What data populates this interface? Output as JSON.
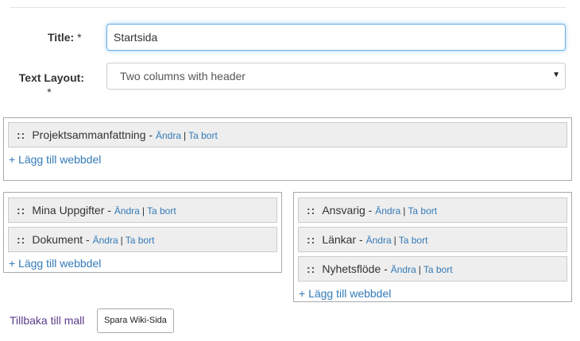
{
  "form": {
    "title_label": "Title:",
    "title_required": "*",
    "title_value": "Startsida",
    "layout_label": "Text Layout:",
    "layout_required": "*",
    "layout_value": "Two columns with header",
    "layout_caret": "▼"
  },
  "zones": {
    "header": {
      "webparts": [
        {
          "drag": "::",
          "name": "Projektsammanfattning",
          "sep": " - ",
          "edit": "Ändra",
          "pipe": "|",
          "remove": "Ta bort"
        }
      ],
      "add_label": "+ Lägg till webbdel"
    },
    "left": {
      "webparts": [
        {
          "drag": "::",
          "name": "Mina Uppgifter",
          "sep": " - ",
          "edit": "Ändra",
          "pipe": "|",
          "remove": "Ta bort"
        },
        {
          "drag": "::",
          "name": "Dokument",
          "sep": " - ",
          "edit": "Ändra",
          "pipe": "|",
          "remove": "Ta bort"
        }
      ],
      "add_label": "+ Lägg till webbdel"
    },
    "right": {
      "webparts": [
        {
          "drag": "::",
          "name": "Ansvarig",
          "sep": " - ",
          "edit": "Ändra",
          "pipe": "|",
          "remove": "Ta bort"
        },
        {
          "drag": "::",
          "name": "Länkar",
          "sep": " - ",
          "edit": "Ändra",
          "pipe": "|",
          "remove": "Ta bort"
        },
        {
          "drag": "::",
          "name": "Nyhetsflöde",
          "sep": " - ",
          "edit": "Ändra",
          "pipe": "|",
          "remove": "Ta bort"
        }
      ],
      "add_label": "+ Lägg till webbdel"
    }
  },
  "footer": {
    "back_label": "Tillbaka till mall",
    "save_label": "Spara Wiki-Sida"
  },
  "colors": {
    "link": "#337ab7",
    "visited_link": "#5b3d8c",
    "focus_border": "#66afe9",
    "webpart_bg": "#eeeeee"
  }
}
